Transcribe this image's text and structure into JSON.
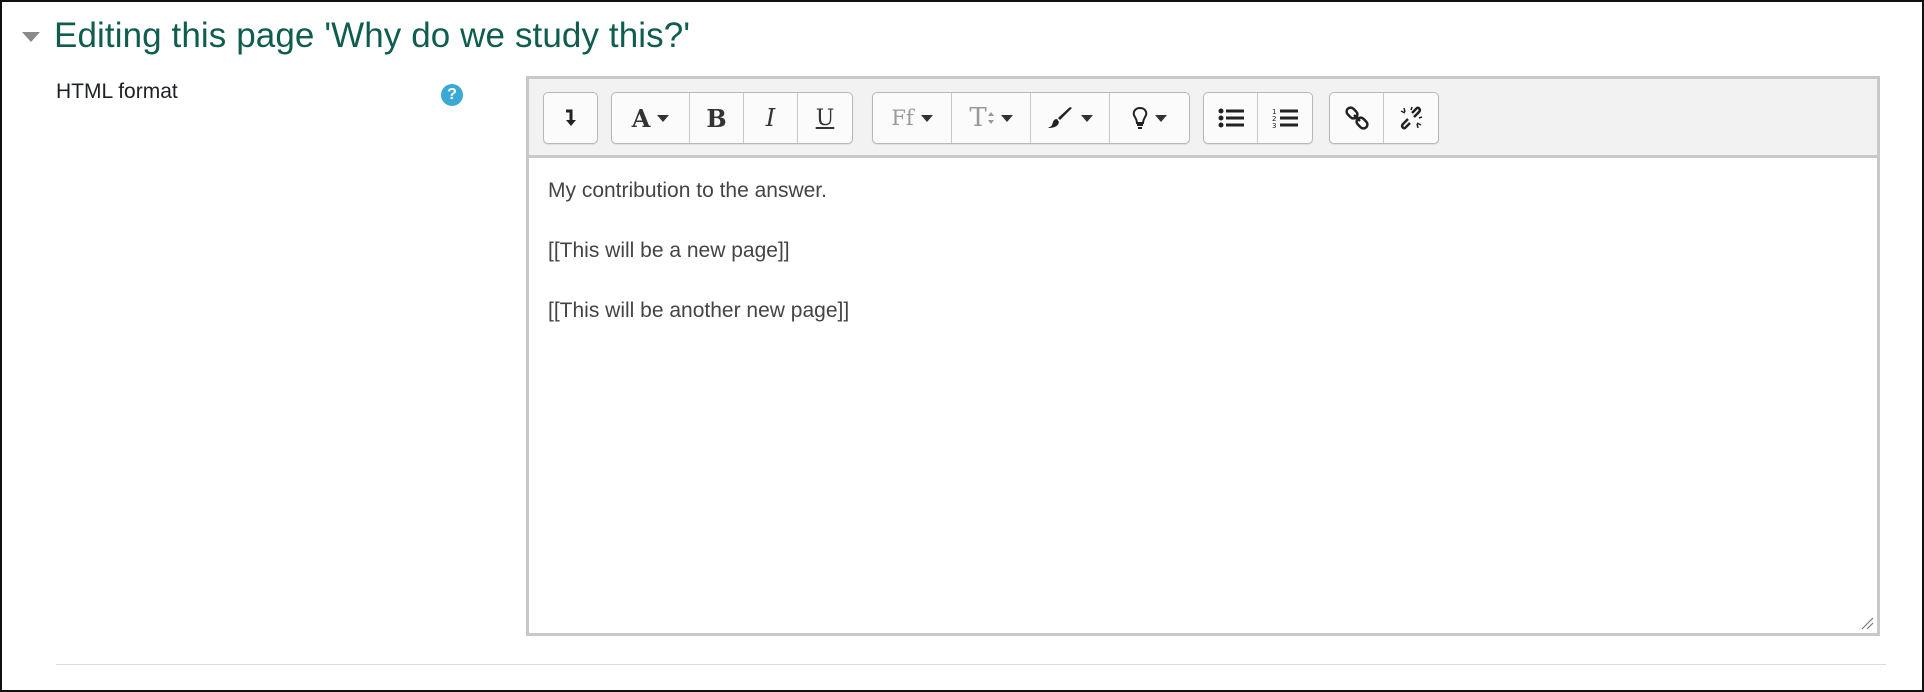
{
  "section": {
    "title": "Editing this page 'Why do we study this?'"
  },
  "field": {
    "label": "HTML format"
  },
  "toolbar": {
    "buttons": {
      "collapse": "collapse-toggle-icon",
      "text_color": "A",
      "bold": "B",
      "italic": "I",
      "underline": "U",
      "font_family": "Ff",
      "font_size": "T",
      "brush": "brush-icon",
      "lightbulb": "lightbulb-icon",
      "bullet_list": "unordered-list-icon",
      "numbered_list": "ordered-list-icon",
      "link": "link-icon",
      "unlink": "unlink-icon"
    }
  },
  "editor": {
    "paragraphs": [
      "My contribution to the answer.",
      "[[This will be a new page]]",
      "[[This will be another new page]]"
    ]
  },
  "colors": {
    "title": "#0f5d4e",
    "help_icon": "#3aa9d6",
    "toolbar_bg": "#f2f2f2"
  }
}
